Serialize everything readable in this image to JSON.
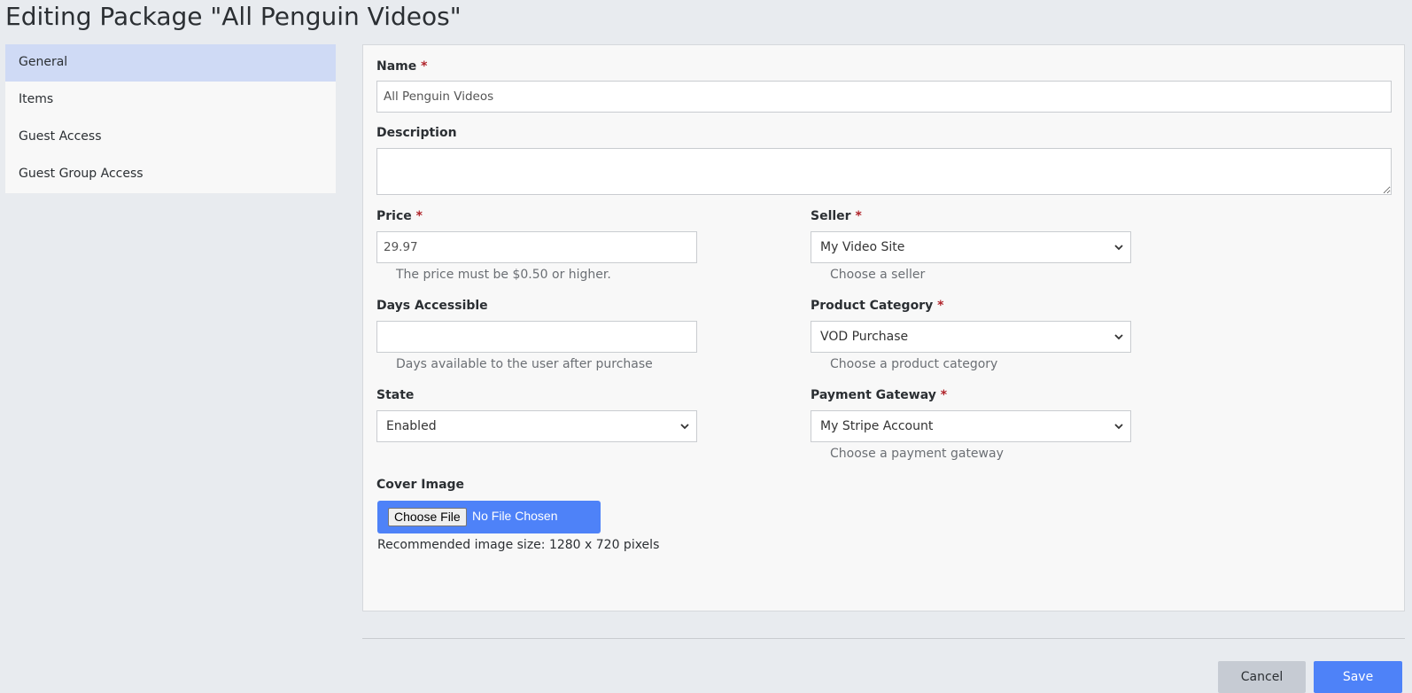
{
  "page": {
    "title": "Editing Package \"All Penguin Videos\""
  },
  "sidebar": {
    "items": [
      {
        "label": "General",
        "active": true
      },
      {
        "label": "Items",
        "active": false
      },
      {
        "label": "Guest Access",
        "active": false
      },
      {
        "label": "Guest Group Access",
        "active": false
      }
    ]
  },
  "form": {
    "required_mark": "*",
    "name": {
      "label": "Name",
      "value": "All Penguin Videos"
    },
    "description": {
      "label": "Description",
      "value": ""
    },
    "price": {
      "label": "Price",
      "value": "29.97",
      "help": "The price must be $0.50 or higher."
    },
    "seller": {
      "label": "Seller",
      "value": "My Video Site",
      "help": "Choose a seller"
    },
    "days_accessible": {
      "label": "Days Accessible",
      "value": "",
      "help": "Days available to the user after purchase"
    },
    "product_category": {
      "label": "Product Category",
      "value": "VOD Purchase",
      "help": "Choose a product category"
    },
    "state": {
      "label": "State",
      "value": "Enabled"
    },
    "payment_gateway": {
      "label": "Payment Gateway",
      "value": "My Stripe Account",
      "help": "Choose a payment gateway"
    },
    "cover_image": {
      "label": "Cover Image",
      "button_label": "Choose File",
      "status": "No File Chosen",
      "help": "Recommended image size: 1280 x 720 pixels"
    }
  },
  "actions": {
    "cancel_label": "Cancel",
    "save_label": "Save"
  },
  "colors": {
    "accent": "#4e82f8",
    "required": "#b0232a",
    "active_nav": "#cfdaf5"
  },
  "icons": {
    "select_caret": "chevron-down-icon",
    "textarea_resize": "resize-handle-icon"
  }
}
